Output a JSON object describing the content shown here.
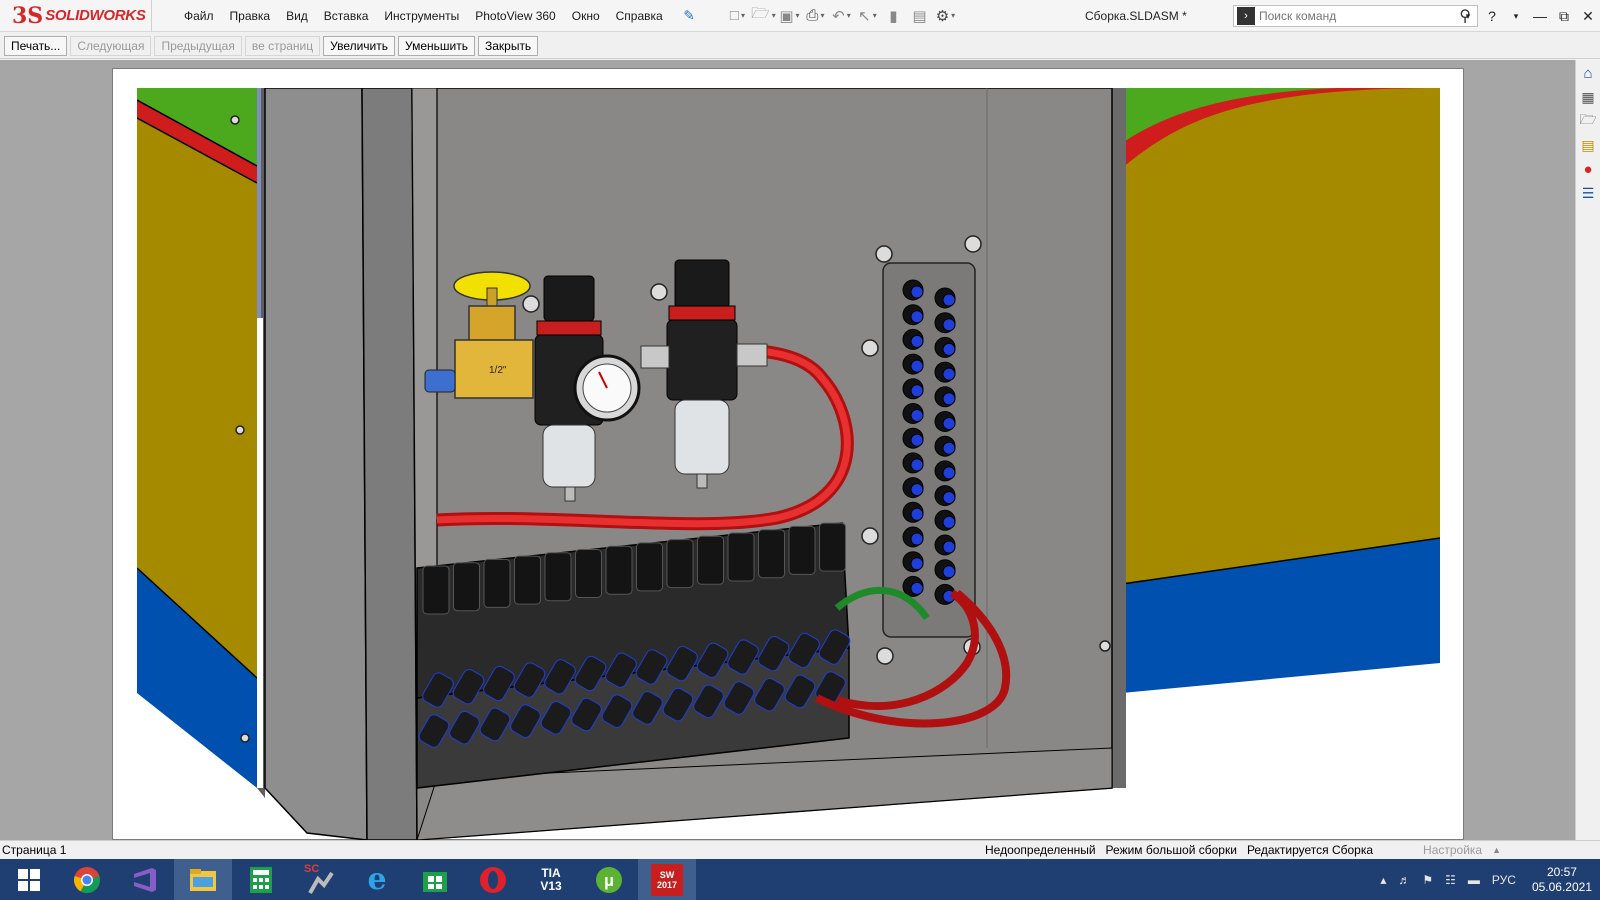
{
  "app": {
    "brand_mark": "3S",
    "brand_name": "SOLIDWORKS",
    "document_title": "Сборка.SLDASM *"
  },
  "menu": {
    "items": [
      {
        "label": "Файл"
      },
      {
        "label": "Правка"
      },
      {
        "label": "Вид"
      },
      {
        "label": "Вставка"
      },
      {
        "label": "Инструменты"
      },
      {
        "label": "PhotoView 360"
      },
      {
        "label": "Окно"
      },
      {
        "label": "Справка"
      }
    ]
  },
  "search": {
    "placeholder": "Поиск команд"
  },
  "print_preview": {
    "buttons": [
      {
        "label": "Печать...",
        "enabled": true
      },
      {
        "label": "Следующая",
        "enabled": false
      },
      {
        "label": "Предыдущая",
        "enabled": false
      },
      {
        "label": "ве страниц",
        "enabled": false
      },
      {
        "label": "Увеличить",
        "enabled": true
      },
      {
        "label": "Уменьшить",
        "enabled": true
      },
      {
        "label": "Закрыть",
        "enabled": true
      }
    ]
  },
  "model": {
    "valve_marking": "1/2\""
  },
  "status_bar": {
    "page": "Страница 1",
    "state": "Недоопределенный",
    "mode": "Режим большой сборки",
    "editing": "Редактируется Сборка",
    "settings": "Настройка"
  },
  "taskbar": {
    "apps": [
      {
        "name": "windows-start-icon"
      },
      {
        "name": "chrome-icon"
      },
      {
        "name": "visual-studio-icon"
      },
      {
        "name": "file-explorer-icon"
      },
      {
        "name": "calculator-icon"
      },
      {
        "name": "sc-tool-icon",
        "label": "SC"
      },
      {
        "name": "internet-explorer-icon"
      },
      {
        "name": "store-icon"
      },
      {
        "name": "opera-icon"
      },
      {
        "name": "tia-portal-icon",
        "label": "TIA V13"
      },
      {
        "name": "utorrent-icon"
      },
      {
        "name": "solidworks-2017-icon",
        "label": "SW 2017"
      }
    ],
    "language": "РУС",
    "time": "20:57",
    "date": "05.06.2021"
  },
  "colors": {
    "brand_red": "#d7262a",
    "taskbar_blue": "#1f3f72",
    "cabinet_gray": "#8a8886",
    "panel_olive": "#a58a00",
    "panel_blue": "#0050b0",
    "panel_green": "#4ca81c",
    "hose_red": "#d81c1c"
  }
}
